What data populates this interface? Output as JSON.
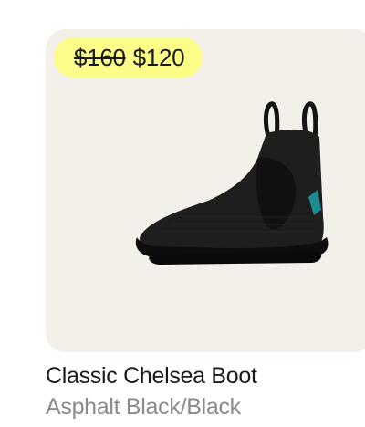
{
  "product": {
    "original_price": "$160",
    "sale_price": "$120",
    "name": "Classic Chelsea Boot",
    "color": "Asphalt Black/Black",
    "image_icon": "chelsea-boot-image"
  },
  "colors": {
    "card_background": "#f2f0e9",
    "badge_background": "#fcfc88",
    "title_text": "#1a1a1a",
    "subtitle_text": "#8a8a8a",
    "accent_tab": "#1d8b91"
  }
}
